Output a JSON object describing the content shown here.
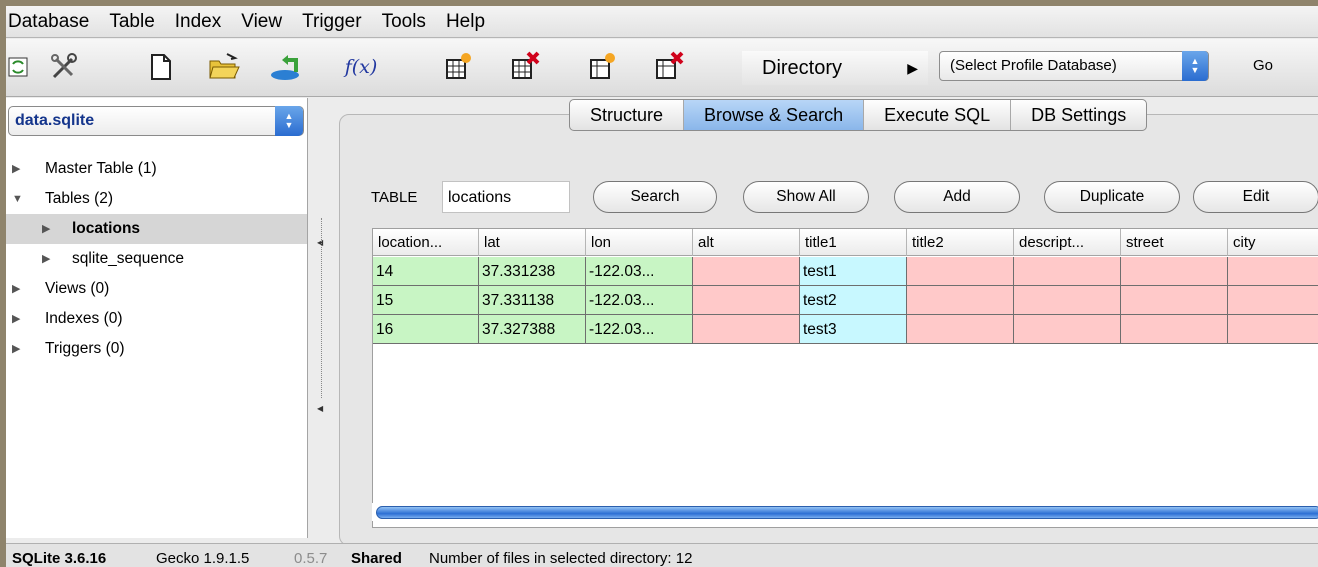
{
  "menubar": {
    "items": [
      "Database",
      "Table",
      "Index",
      "View",
      "Trigger",
      "Tools",
      "Help"
    ]
  },
  "toolbar": {
    "icons": [
      "refresh-icon",
      "tools-icon",
      "new-file-icon",
      "open-folder-icon",
      "attach-icon",
      "function-icon",
      "create-table-icon",
      "drop-table-icon",
      "create-index-icon",
      "drop-index-icon"
    ],
    "function_label": "f(x)",
    "directory_label": "Directory",
    "profile_select": "(Select Profile Database)",
    "go_label": "Go",
    "accent": "#2a6cd0"
  },
  "left_panel": {
    "db_select": "data.sqlite",
    "tree": [
      {
        "label": "Master Table (1)",
        "level": 0,
        "expanded": false
      },
      {
        "label": "Tables (2)",
        "level": 0,
        "expanded": true
      },
      {
        "label": "locations",
        "level": 1,
        "expanded": false,
        "selected": true
      },
      {
        "label": "sqlite_sequence",
        "level": 1,
        "expanded": false
      },
      {
        "label": "Views (0)",
        "level": 0,
        "expanded": false
      },
      {
        "label": "Indexes (0)",
        "level": 0,
        "expanded": false
      },
      {
        "label": "Triggers (0)",
        "level": 0,
        "expanded": false
      }
    ]
  },
  "tabs": [
    {
      "label": "Structure",
      "active": false
    },
    {
      "label": "Browse & Search",
      "active": true
    },
    {
      "label": "Execute SQL",
      "active": false
    },
    {
      "label": "DB Settings",
      "active": false
    }
  ],
  "search": {
    "table_label": "TABLE",
    "table_value": "locations",
    "buttons": [
      "Search",
      "Show All",
      "Add",
      "Duplicate",
      "Edit"
    ]
  },
  "grid": {
    "columns": [
      "location...",
      "lat",
      "lon",
      "alt",
      "title1",
      "title2",
      "descript...",
      "street",
      "city"
    ],
    "rows": [
      [
        "14",
        "37.331238",
        "-122.03...",
        "",
        "test1",
        "",
        "",
        "",
        ""
      ],
      [
        "15",
        "37.331138",
        "-122.03...",
        "",
        "test2",
        "",
        "",
        "",
        ""
      ],
      [
        "16",
        "37.327388",
        "-122.03...",
        "",
        "test3",
        "",
        "",
        "",
        ""
      ]
    ],
    "column_colors": [
      "#c8f5c4",
      "#c8f5c4",
      "#c8f5c4",
      "#ffc9c9",
      "#c8f8ff",
      "#ffc9c9",
      "#ffc9c9",
      "#ffc9c9",
      "#ffc9c9"
    ]
  },
  "status": {
    "sqlite": "SQLite 3.6.16",
    "gecko": "Gecko 1.9.1.5",
    "version": "0.5.7",
    "mode": "Shared",
    "files": "Number of files in selected directory: 12"
  }
}
